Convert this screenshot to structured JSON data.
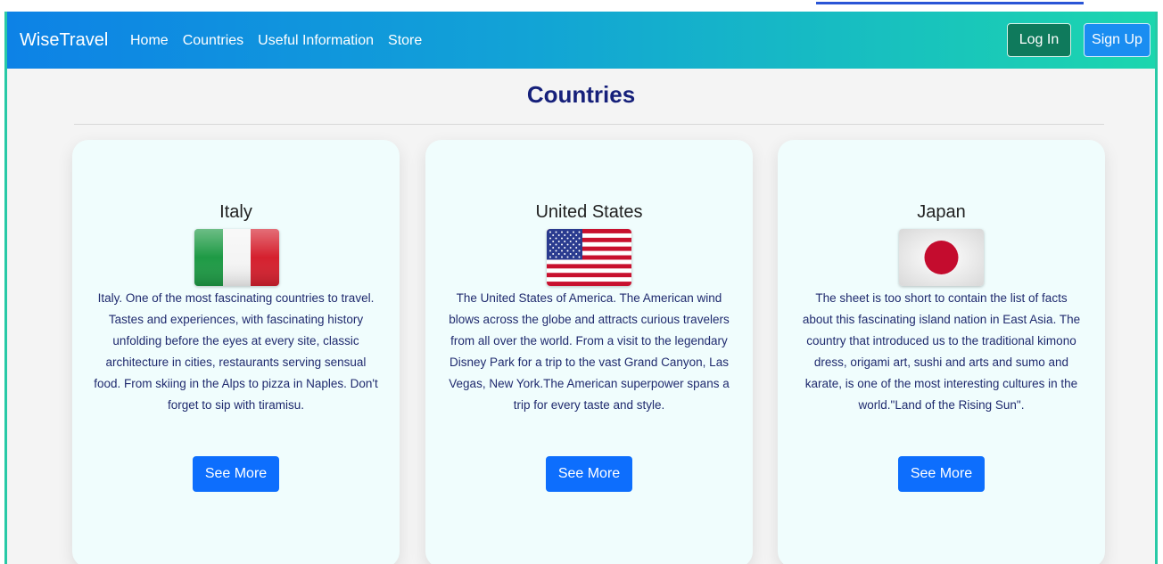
{
  "nav": {
    "brand": "WiseTravel",
    "links": [
      "Home",
      "Countries",
      "Useful Information",
      "Store"
    ],
    "login_label": "Log In",
    "signup_label": "Sign Up"
  },
  "page": {
    "title": "Countries"
  },
  "cards": [
    {
      "title": "Italy",
      "flag_icon": "italy-flag-icon",
      "text": "Italy. One of the most fascinating countries to travel. Tastes and experiences, with fascinating history unfolding before the eyes at every site, classic architecture in cities, restaurants serving sensual food. From skiing in the Alps to pizza in Naples. Don't forget to sip with tiramisu.",
      "button": "See More"
    },
    {
      "title": "United States",
      "flag_icon": "usa-flag-icon",
      "text": "The United States of America. The American wind blows across the globe and attracts curious travelers from all over the world. From a visit to the legendary Disney Park for a trip to the vast Grand Canyon, Las Vegas, New York.The American superpower spans a trip for every taste and style.",
      "button": "See More"
    },
    {
      "title": "Japan",
      "flag_icon": "japan-flag-icon",
      "text": "The sheet is too short to contain the list of facts about this fascinating island nation in East Asia. The country that introduced us to the traditional kimono dress, origami art, sushi and arts and sumo and karate, is one of the most interesting cultures in the world.\"Land of the Rising Sun\".",
      "button": "See More"
    }
  ],
  "colors": {
    "navbar_start": "#0d82e6",
    "navbar_end": "#1cd6ae",
    "title": "#16207a",
    "button": "#0d6efd",
    "login": "#0f7a5c"
  }
}
